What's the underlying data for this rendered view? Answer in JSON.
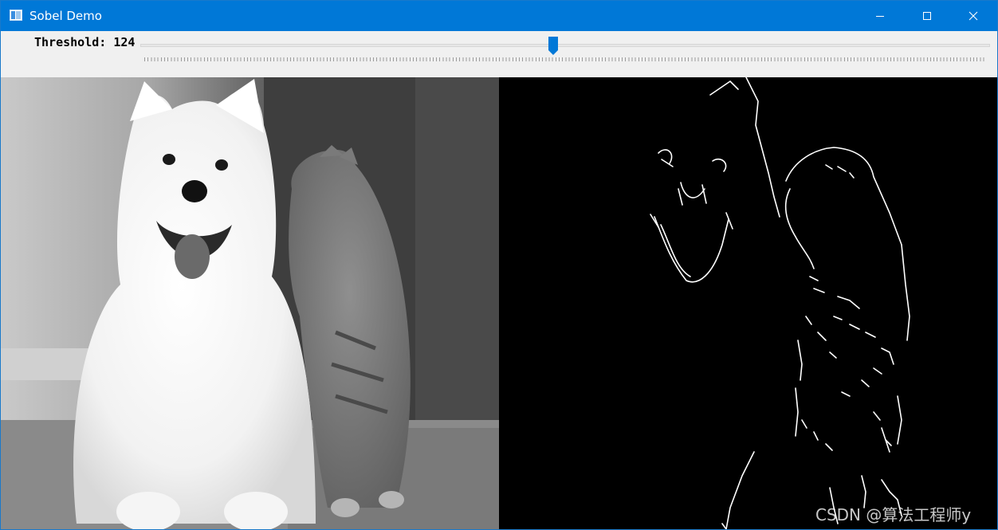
{
  "window": {
    "title": "Sobel Demo",
    "icon": "app-window-icon",
    "controls": {
      "minimize_icon": "minimize-icon",
      "maximize_icon": "maximize-icon",
      "close_icon": "close-icon"
    },
    "accent_color": "#0078d7"
  },
  "trackbar": {
    "label": "Threshold:",
    "value": "124",
    "numeric_value": 124,
    "max": 255,
    "thumb_color": "#0078d7"
  },
  "images": {
    "left_panel": "original-grayscale-image",
    "right_panel": "sobel-edge-image",
    "watermark": "CSDN @算法工程师y"
  }
}
